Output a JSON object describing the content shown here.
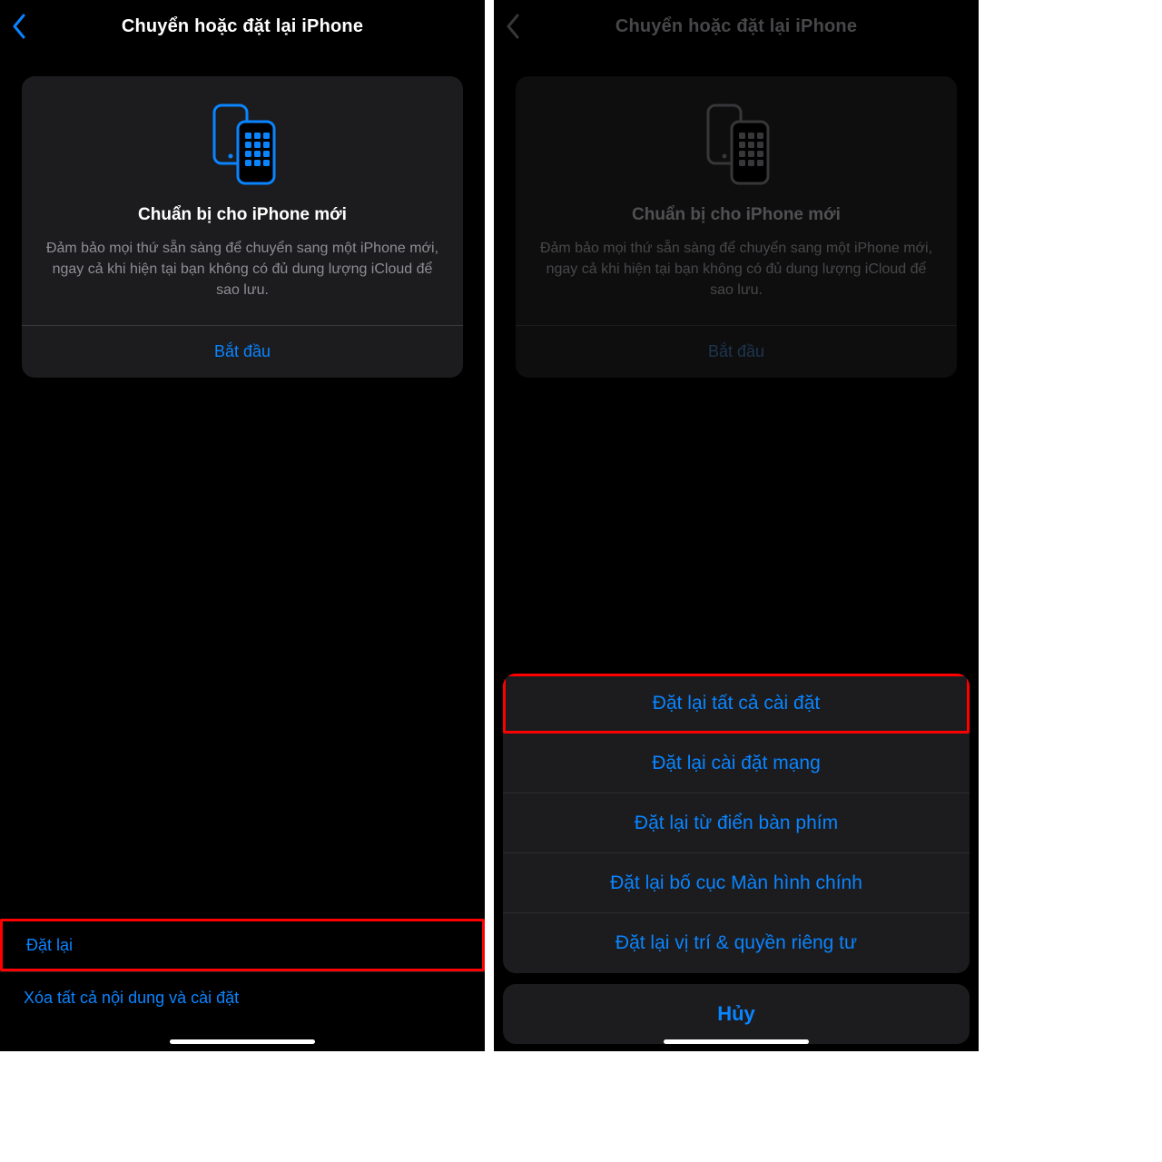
{
  "left": {
    "nav_title": "Chuyển hoặc đặt lại iPhone",
    "card": {
      "heading": "Chuẩn bị cho iPhone mới",
      "body": "Đảm bảo mọi thứ sẵn sàng để chuyển sang một iPhone mới, ngay cả khi hiện tại bạn không có đủ dung lượng iCloud để sao lưu.",
      "action": "Bắt đầu"
    },
    "list": {
      "reset": "Đặt lại",
      "erase": "Xóa tất cả nội dung và cài đặt"
    }
  },
  "right": {
    "nav_title": "Chuyển hoặc đặt lại iPhone",
    "card": {
      "heading": "Chuẩn bị cho iPhone mới",
      "body": "Đảm bảo mọi thứ sẵn sàng để chuyển sang một iPhone mới, ngay cả khi hiện tại bạn không có đủ dung lượng iCloud để sao lưu.",
      "action": "Bắt đầu"
    },
    "sheet": {
      "items": [
        "Đặt lại tất cả cài đặt",
        "Đặt lại cài đặt mạng",
        "Đặt lại từ điển bàn phím",
        "Đặt lại bố cục Màn hình chính",
        "Đặt lại vị trí & quyền riêng tư"
      ],
      "cancel": "Hủy"
    }
  },
  "colors": {
    "accent": "#0a84ff",
    "highlight": "#ff0000"
  }
}
